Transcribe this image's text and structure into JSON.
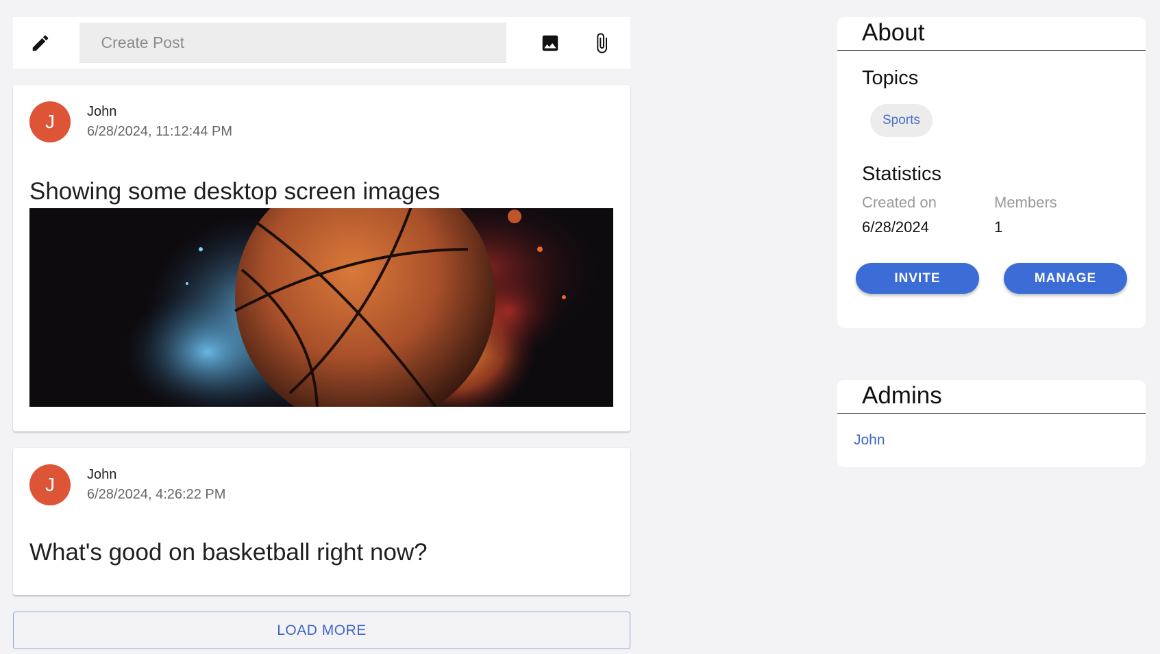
{
  "create_post": {
    "placeholder": "Create Post",
    "edit_icon": "pencil-icon",
    "image_icon": "image-icon",
    "attach_icon": "paperclip-icon"
  },
  "posts": [
    {
      "avatar_initial": "J",
      "author": "John",
      "timestamp": "6/28/2024, 11:12:44 PM",
      "title": "Showing some desktop screen images",
      "has_image": true
    },
    {
      "avatar_initial": "J",
      "author": "John",
      "timestamp": "6/28/2024, 4:26:22 PM",
      "title": "What's good on basketball right now?",
      "has_image": false
    }
  ],
  "load_more_label": "LOAD MORE",
  "about": {
    "title": "About",
    "topics_title": "Topics",
    "topics": [
      "Sports"
    ],
    "statistics_title": "Statistics",
    "created_on_label": "Created on",
    "created_on_value": "6/28/2024",
    "members_label": "Members",
    "members_value": "1",
    "invite_label": "INVITE",
    "manage_label": "MANAGE"
  },
  "admins": {
    "title": "Admins",
    "names": [
      "John"
    ]
  },
  "colors": {
    "page_bg": "#f3f3f5",
    "accent": "#3c6dd6",
    "avatar": "#de5437",
    "link": "#3f66c7"
  }
}
